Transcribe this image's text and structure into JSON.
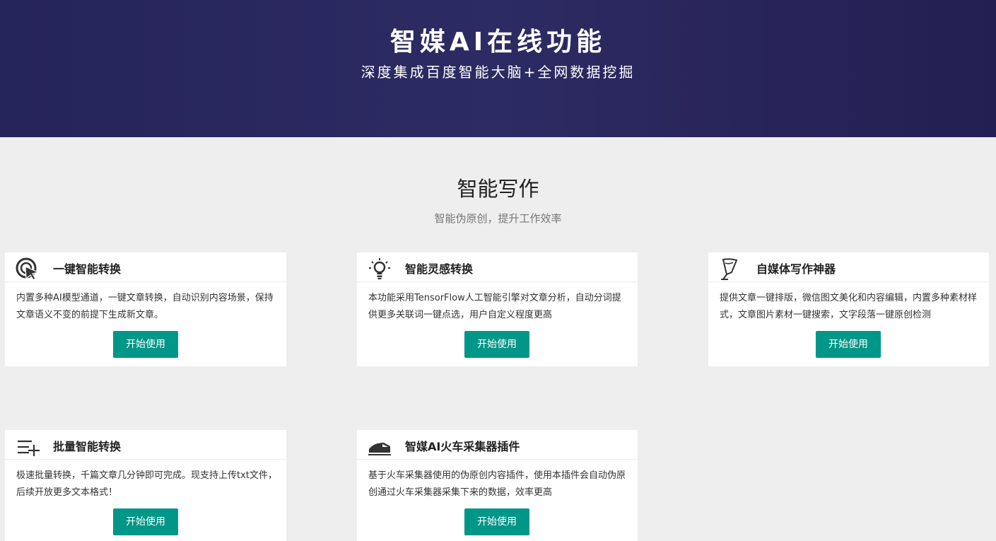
{
  "hero": {
    "title": "智媒AI在线功能",
    "subtitle": "深度集成百度智能大脑+全网数据挖掘"
  },
  "section": {
    "title": "智能写作",
    "subtitle": "智能伪原创，提升工作效率"
  },
  "cards": [
    {
      "icon": "cursor-target-icon",
      "title": "一键智能转换",
      "description": "内置多种AI模型通道，一键文章转换，自动识别内容场景，保持文章语义不变的前提下生成新文章。",
      "button": "开始使用"
    },
    {
      "icon": "lightbulb-icon",
      "title": "智能灵感转换",
      "description": "本功能采用TensorFlow人工智能引擎对文章分析，自动分词提供更多关联词一键点选，用户自定义程度更高",
      "button": "开始使用"
    },
    {
      "icon": "pen-nib-icon",
      "title": "自媒体写作神器",
      "description": "提供文章一键排版，微信图文美化和内容编辑，内置多种素材样式，文章图片素材一键搜索，文字段落一键原创检测",
      "button": "开始使用"
    },
    {
      "icon": "list-add-icon",
      "title": "批量智能转换",
      "description": "极速批量转换，千篇文章几分钟即可完成。现支持上传txt文件，后续开放更多文本格式！",
      "button": "开始使用"
    },
    {
      "icon": "train-icon",
      "title": "智媒AI火车采集器插件",
      "description": "基于火车采集器使用的伪原创内容插件，使用本插件会自动伪原创通过火车采集器采集下来的数据，效率更高",
      "button": "开始使用"
    }
  ],
  "colors": {
    "hero_bg": "#27265c",
    "page_bg": "#eeeeee",
    "button": "#009688"
  }
}
